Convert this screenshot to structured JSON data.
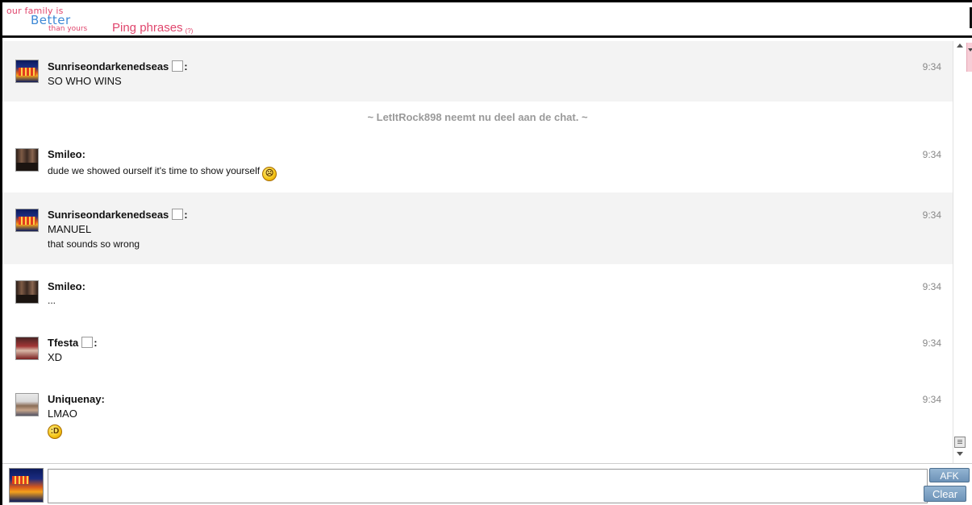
{
  "header": {
    "logo": {
      "line1": "our family is",
      "line2": "Better",
      "line3": "than yours"
    },
    "ping_label": "Ping phrases",
    "ping_help": "(?)"
  },
  "messages": [
    {
      "user": "Sunriseondarkenedseas",
      "has_checkbox": true,
      "time": "9:34",
      "lines": [
        "SO WHO WINS"
      ]
    },
    {
      "system": "~ LetItRock898 neemt nu deel aan de chat. ~"
    },
    {
      "user": "Smileo",
      "has_checkbox": false,
      "time": "9:34",
      "lines": [
        "dude we showed ourself it's time to show yourself"
      ],
      "emoji": "sad-face"
    },
    {
      "user": "Sunriseondarkenedseas",
      "has_checkbox": true,
      "time": "9:34",
      "lines": [
        "MANUEL",
        "that sounds so wrong"
      ]
    },
    {
      "user": "Smileo",
      "has_checkbox": false,
      "time": "9:34",
      "lines": [
        "..."
      ]
    },
    {
      "user": "Tfesta",
      "has_checkbox": true,
      "time": "9:34",
      "lines": [
        "XD"
      ]
    },
    {
      "user": "Uniquenay",
      "has_checkbox": false,
      "time": "9:34",
      "lines": [
        "LMAO"
      ],
      "emoji": "laughing-face",
      "emoji_text": ":D"
    }
  ],
  "name_suffix": ":",
  "composer": {
    "input_value": "",
    "afk_label": "AFK",
    "clear_label": "Clear"
  },
  "colors": {
    "accent_pink": "#e0466d",
    "logo_blue": "#3e89d6",
    "button_blue": "#6d93b8",
    "row_shade": "#f3f3f3",
    "system_text": "#9a9a9a"
  }
}
